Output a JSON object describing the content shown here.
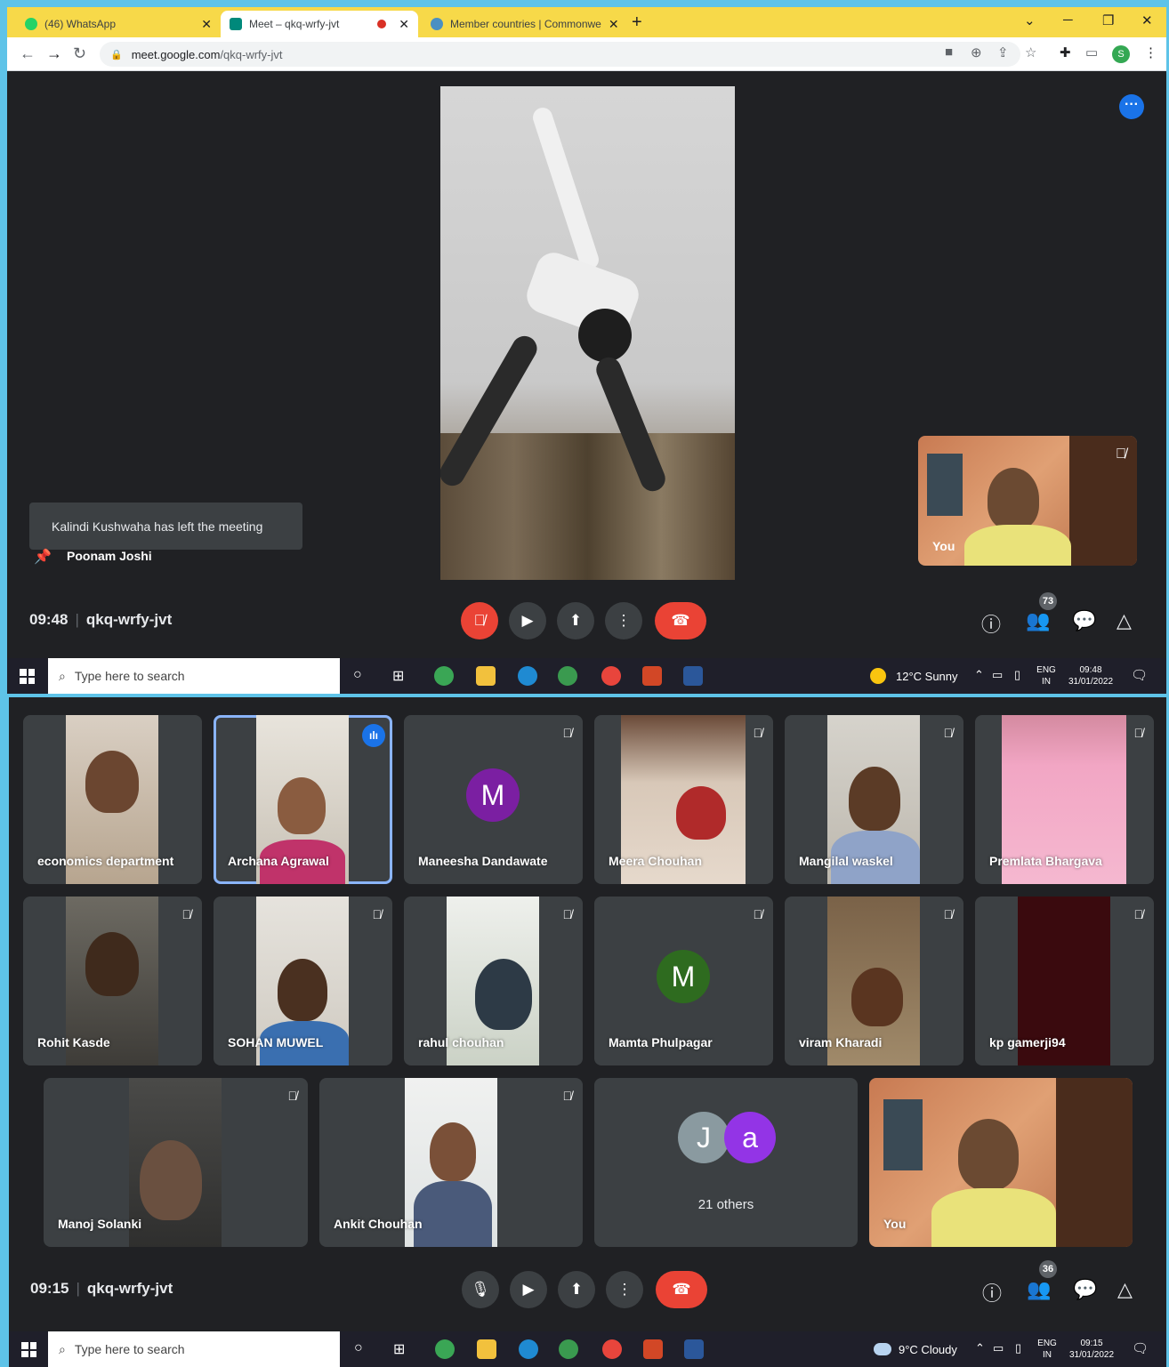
{
  "browser": {
    "tabs": [
      {
        "label": "(46) WhatsApp",
        "icon": "whatsapp-icon"
      },
      {
        "label": "Meet – qkq-wrfy-jvt",
        "icon": "google-meet-icon"
      },
      {
        "label": "Member countries | Commonwe",
        "icon": "commonwealth-icon"
      }
    ],
    "new_tab": "+",
    "url_host": "meet.google.com",
    "url_path": "/qkq-wrfy-jvt",
    "profile_initial": "S"
  },
  "meet_top": {
    "toast": "Kalindi Kushwaha has left the meeting",
    "pinned_name": "Poonam Joshi",
    "self_label": "You",
    "time": "09:48",
    "meeting_code": "qkq-wrfy-jvt",
    "participant_count": "73"
  },
  "taskbar_top": {
    "search_placeholder": "Type here to search",
    "weather": "12°C  Sunny",
    "lang": "ENG",
    "region": "IN",
    "clock": "09:48",
    "date": "31/01/2022"
  },
  "meet_bottom": {
    "tiles": [
      {
        "name": "economics department"
      },
      {
        "name": "Archana Agrawal"
      },
      {
        "name": "Maneesha Dandawate",
        "initial": "M"
      },
      {
        "name": "Meera Chouhan"
      },
      {
        "name": "Mangilal waskel"
      },
      {
        "name": "Premlata Bhargava"
      },
      {
        "name": "Rohit Kasde"
      },
      {
        "name": "SOHAN MUWEL"
      },
      {
        "name": "rahul chouhan"
      },
      {
        "name": "Mamta Phulpagar",
        "initial": "M"
      },
      {
        "name": "viram Kharadi"
      },
      {
        "name": "kp gamerji94"
      },
      {
        "name": "Manoj Solanki"
      },
      {
        "name": "Ankit Chouhan"
      },
      {
        "name": "You"
      }
    ],
    "others_initials": [
      "J",
      "a"
    ],
    "others_label": "21 others",
    "time": "09:15",
    "meeting_code": "qkq-wrfy-jvt",
    "participant_count": "36"
  },
  "taskbar_bottom": {
    "search_placeholder": "Type here to search",
    "weather": "9°C  Cloudy",
    "lang": "ENG",
    "region": "IN",
    "clock": "09:15",
    "date": "31/01/2022"
  },
  "colors": {
    "meet_bg": "#202124",
    "tile_bg": "#3c4043",
    "end_call": "#ea4335",
    "accent": "#1a73e8",
    "avatar_purple": "#7b1fa2",
    "avatar_green": "#2e6b1f",
    "tabbar": "#f7d949"
  }
}
